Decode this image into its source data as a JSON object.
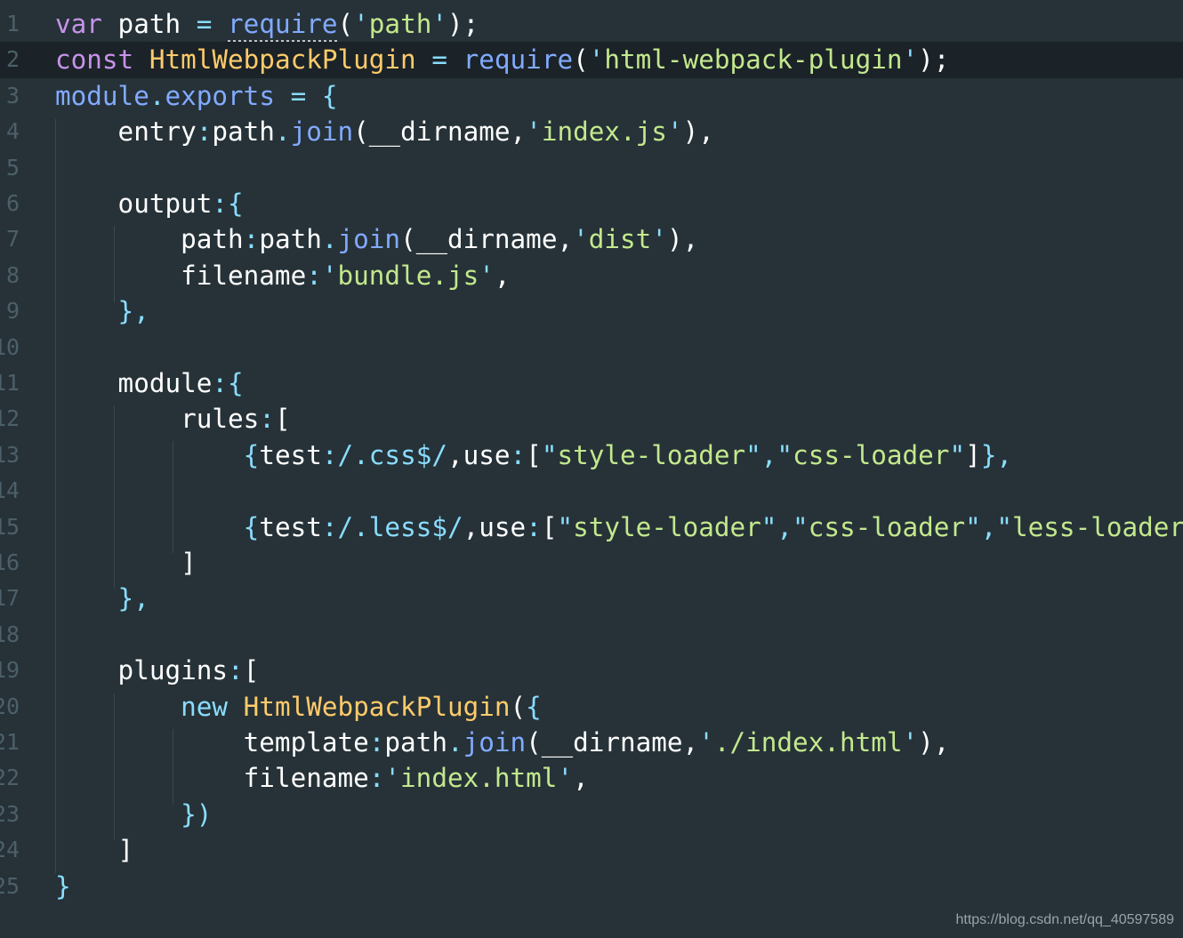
{
  "theme": {
    "background": "#263238",
    "active_line": "#1b2328",
    "line_number": "#4d5f68",
    "keyword": "#c792ea",
    "class": "#ffcb6b",
    "function": "#82aaff",
    "string": "#c3e88d",
    "punctuation": "#89ddff",
    "plain": "#ffffff"
  },
  "editor": {
    "active_line": 2,
    "lines": [
      {
        "number": "1",
        "tokens": [
          {
            "t": "var",
            "c": "kw"
          },
          {
            "t": " path ",
            "c": "pln"
          },
          {
            "t": "=",
            "c": "pun"
          },
          {
            "t": " ",
            "c": "pln"
          },
          {
            "t": "require",
            "c": "fn",
            "squiggle": true
          },
          {
            "t": "(",
            "c": "pln"
          },
          {
            "t": "'",
            "c": "pun"
          },
          {
            "t": "path",
            "c": "str"
          },
          {
            "t": "'",
            "c": "pun"
          },
          {
            "t": ");",
            "c": "pln"
          }
        ]
      },
      {
        "number": "2",
        "tokens": [
          {
            "t": "const",
            "c": "kw"
          },
          {
            "t": " ",
            "c": "pln"
          },
          {
            "t": "HtmlWebpackPlugin",
            "c": "cls"
          },
          {
            "t": " ",
            "c": "pln"
          },
          {
            "t": "=",
            "c": "pun"
          },
          {
            "t": " ",
            "c": "pln"
          },
          {
            "t": "require",
            "c": "fn"
          },
          {
            "t": "(",
            "c": "pln"
          },
          {
            "t": "'",
            "c": "pun"
          },
          {
            "t": "html-webpack-plugin",
            "c": "str"
          },
          {
            "t": "'",
            "c": "pun"
          },
          {
            "t": ");",
            "c": "pln"
          }
        ]
      },
      {
        "number": "3",
        "tokens": [
          {
            "t": "module",
            "c": "fn"
          },
          {
            "t": ".",
            "c": "pun"
          },
          {
            "t": "exports",
            "c": "fn"
          },
          {
            "t": " ",
            "c": "pln"
          },
          {
            "t": "=",
            "c": "pun"
          },
          {
            "t": " ",
            "c": "pln"
          },
          {
            "t": "{",
            "c": "pun"
          }
        ]
      },
      {
        "number": "4",
        "tokens": [
          {
            "t": "    entry",
            "c": "pln"
          },
          {
            "t": ":",
            "c": "pun"
          },
          {
            "t": "path",
            "c": "pln"
          },
          {
            "t": ".",
            "c": "pun"
          },
          {
            "t": "join",
            "c": "fn"
          },
          {
            "t": "(__dirname,",
            "c": "pln"
          },
          {
            "t": "'",
            "c": "pun"
          },
          {
            "t": "index.js",
            "c": "str"
          },
          {
            "t": "'",
            "c": "pun"
          },
          {
            "t": "),",
            "c": "pln"
          }
        ]
      },
      {
        "number": "5",
        "tokens": []
      },
      {
        "number": "6",
        "tokens": [
          {
            "t": "    output",
            "c": "pln"
          },
          {
            "t": ":{",
            "c": "pun"
          }
        ]
      },
      {
        "number": "7",
        "tokens": [
          {
            "t": "        path",
            "c": "pln"
          },
          {
            "t": ":",
            "c": "pun"
          },
          {
            "t": "path",
            "c": "pln"
          },
          {
            "t": ".",
            "c": "pun"
          },
          {
            "t": "join",
            "c": "fn"
          },
          {
            "t": "(__dirname,",
            "c": "pln"
          },
          {
            "t": "'",
            "c": "pun"
          },
          {
            "t": "dist",
            "c": "str"
          },
          {
            "t": "'",
            "c": "pun"
          },
          {
            "t": "),",
            "c": "pln"
          }
        ]
      },
      {
        "number": "8",
        "tokens": [
          {
            "t": "        filename",
            "c": "pln"
          },
          {
            "t": ":",
            "c": "pun"
          },
          {
            "t": "'",
            "c": "pun"
          },
          {
            "t": "bundle.js",
            "c": "str"
          },
          {
            "t": "'",
            "c": "pun"
          },
          {
            "t": ",",
            "c": "pln"
          }
        ]
      },
      {
        "number": "9",
        "tokens": [
          {
            "t": "    },",
            "c": "pun"
          }
        ]
      },
      {
        "number": "10",
        "tokens": []
      },
      {
        "number": "11",
        "tokens": [
          {
            "t": "    module",
            "c": "pln"
          },
          {
            "t": ":{",
            "c": "pun"
          }
        ]
      },
      {
        "number": "12",
        "tokens": [
          {
            "t": "        rules",
            "c": "pln"
          },
          {
            "t": ":",
            "c": "pun"
          },
          {
            "t": "[",
            "c": "pln"
          }
        ]
      },
      {
        "number": "13",
        "tokens": [
          {
            "t": "            ",
            "c": "pln"
          },
          {
            "t": "{",
            "c": "pun"
          },
          {
            "t": "test",
            "c": "pln"
          },
          {
            "t": ":",
            "c": "pun"
          },
          {
            "t": "/.css$/",
            "c": "rx"
          },
          {
            "t": ",use",
            "c": "pln"
          },
          {
            "t": ":",
            "c": "pun"
          },
          {
            "t": "[",
            "c": "pln"
          },
          {
            "t": "\"",
            "c": "pun"
          },
          {
            "t": "style-loader",
            "c": "str"
          },
          {
            "t": "\",\"",
            "c": "pun"
          },
          {
            "t": "css-loader",
            "c": "str"
          },
          {
            "t": "\"",
            "c": "pun"
          },
          {
            "t": "]",
            "c": "pln"
          },
          {
            "t": "},",
            "c": "pun"
          }
        ]
      },
      {
        "number": "14",
        "tokens": []
      },
      {
        "number": "15",
        "tokens": [
          {
            "t": "            ",
            "c": "pln"
          },
          {
            "t": "{",
            "c": "pun"
          },
          {
            "t": "test",
            "c": "pln"
          },
          {
            "t": ":",
            "c": "pun"
          },
          {
            "t": "/.less$/",
            "c": "rx"
          },
          {
            "t": ",use",
            "c": "pln"
          },
          {
            "t": ":",
            "c": "pun"
          },
          {
            "t": "[",
            "c": "pln"
          },
          {
            "t": "\"",
            "c": "pun"
          },
          {
            "t": "style-loader",
            "c": "str"
          },
          {
            "t": "\",\"",
            "c": "pun"
          },
          {
            "t": "css-loader",
            "c": "str"
          },
          {
            "t": "\",\"",
            "c": "pun"
          },
          {
            "t": "less-loader",
            "c": "str"
          },
          {
            "t": "\"",
            "c": "pun"
          },
          {
            "t": "]",
            "c": "pln"
          },
          {
            "t": "},",
            "c": "pun"
          }
        ]
      },
      {
        "number": "16",
        "tokens": [
          {
            "t": "        ]",
            "c": "pln"
          }
        ]
      },
      {
        "number": "17",
        "tokens": [
          {
            "t": "    },",
            "c": "pun"
          }
        ]
      },
      {
        "number": "18",
        "tokens": []
      },
      {
        "number": "19",
        "tokens": [
          {
            "t": "    plugins",
            "c": "pln"
          },
          {
            "t": ":",
            "c": "pun"
          },
          {
            "t": "[",
            "c": "pln"
          }
        ]
      },
      {
        "number": "20",
        "tokens": [
          {
            "t": "        ",
            "c": "pln"
          },
          {
            "t": "new",
            "c": "kw2"
          },
          {
            "t": " ",
            "c": "pln"
          },
          {
            "t": "HtmlWebpackPlugin",
            "c": "cls"
          },
          {
            "t": "(",
            "c": "pln"
          },
          {
            "t": "{",
            "c": "pun"
          }
        ]
      },
      {
        "number": "21",
        "tokens": [
          {
            "t": "            template",
            "c": "pln"
          },
          {
            "t": ":",
            "c": "pun"
          },
          {
            "t": "path",
            "c": "pln"
          },
          {
            "t": ".",
            "c": "pun"
          },
          {
            "t": "join",
            "c": "fn"
          },
          {
            "t": "(__dirname,",
            "c": "pln"
          },
          {
            "t": "'",
            "c": "pun"
          },
          {
            "t": "./index.html",
            "c": "str"
          },
          {
            "t": "'",
            "c": "pun"
          },
          {
            "t": "),",
            "c": "pln"
          }
        ]
      },
      {
        "number": "22",
        "tokens": [
          {
            "t": "            filename",
            "c": "pln"
          },
          {
            "t": ":",
            "c": "pun"
          },
          {
            "t": "'",
            "c": "pun"
          },
          {
            "t": "index.html",
            "c": "str"
          },
          {
            "t": "'",
            "c": "pun"
          },
          {
            "t": ",",
            "c": "pln"
          }
        ]
      },
      {
        "number": "23",
        "tokens": [
          {
            "t": "        ",
            "c": "pln"
          },
          {
            "t": "})",
            "c": "pun"
          }
        ]
      },
      {
        "number": "24",
        "tokens": [
          {
            "t": "    ]",
            "c": "pln"
          }
        ]
      },
      {
        "number": "25",
        "tokens": [
          {
            "t": "}",
            "c": "pun"
          }
        ]
      }
    ]
  },
  "watermark": "https://blog.csdn.net/qq_40597589"
}
